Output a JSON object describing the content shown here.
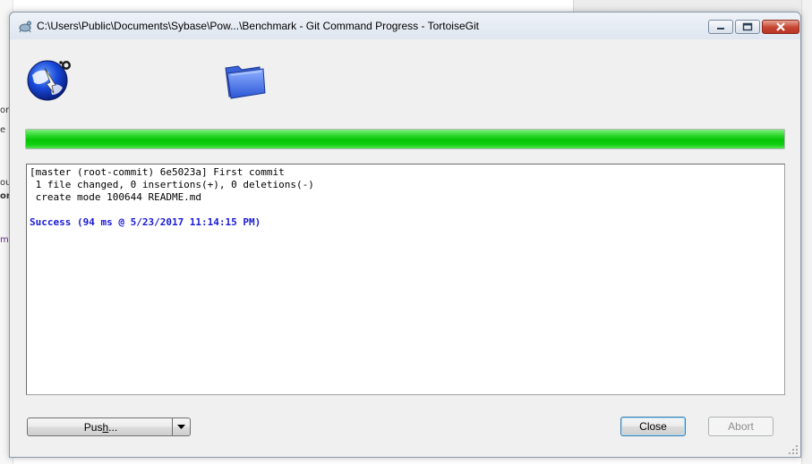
{
  "window": {
    "title": "C:\\Users\\Public\\Documents\\Sybase\\Pow...\\Benchmark - Git Command Progress - TortoiseGit"
  },
  "background_fragments": [
    "om",
    "e",
    "oub",
    "one",
    "mo"
  ],
  "icons": {
    "title": "tortoisegit-icon",
    "left": "globe-arrow-icon",
    "right": "folder-icon"
  },
  "progress": {
    "value": 1.0,
    "color": "#06c406"
  },
  "log": {
    "lines": [
      "[master (root-commit) 6e5023a] First commit",
      " 1 file changed, 0 insertions(+), 0 deletions(-)",
      " create mode 100644 README.md"
    ],
    "success": "Success (94 ms @ 5/23/2017 11:14:15 PM)",
    "success_color": "#1a1ad8"
  },
  "buttons": {
    "push_pre": "Pus",
    "push_mnemonic": "h",
    "push_post": "...",
    "close": "Close",
    "abort": "Abort"
  }
}
